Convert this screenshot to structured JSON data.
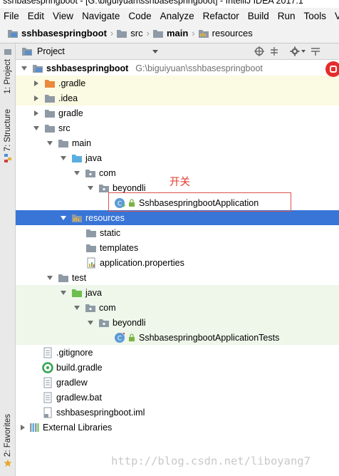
{
  "window": {
    "title": "sshbasespringboot - [G:\\biguiyuan\\sshbasespringboot] - IntelliJ IDEA 2017.1"
  },
  "menu": [
    "File",
    "Edit",
    "View",
    "Navigate",
    "Code",
    "Analyze",
    "Refactor",
    "Build",
    "Run",
    "Tools",
    "VCS"
  ],
  "breadcrumb": {
    "items": [
      "sshbasespringboot",
      "src",
      "main",
      "resources"
    ]
  },
  "left_tabs": {
    "project": "1: Project",
    "structure": "7: Structure",
    "favorites": "2: Favorites"
  },
  "panel": {
    "title": "Project"
  },
  "tree": {
    "root_name": "sshbasespringboot",
    "root_path": "G:\\biguiyuan\\sshbasespringboot",
    "rows": [
      {
        "label": ".gradle"
      },
      {
        "label": ".idea"
      },
      {
        "label": "gradle"
      },
      {
        "label": "src"
      },
      {
        "label": "main"
      },
      {
        "label": "java"
      },
      {
        "label": "com"
      },
      {
        "label": "beyondli"
      },
      {
        "label": "SshbasespringbootApplication"
      },
      {
        "label": "resources"
      },
      {
        "label": "static"
      },
      {
        "label": "templates"
      },
      {
        "label": "application.properties"
      },
      {
        "label": "test"
      },
      {
        "label": "java"
      },
      {
        "label": "com"
      },
      {
        "label": "beyondli"
      },
      {
        "label": "SshbasespringbootApplicationTests"
      },
      {
        "label": ".gitignore"
      },
      {
        "label": "build.gradle"
      },
      {
        "label": "gradlew"
      },
      {
        "label": "gradlew.bat"
      },
      {
        "label": "sshbasespringboot.iml"
      },
      {
        "label": "External Libraries"
      }
    ]
  },
  "annotation": "开关",
  "watermark": "http://blog.csdn.net/liboyang7",
  "colors": {
    "selection": "#3875d7",
    "annotation": "#e03b2f",
    "highlight_yellow": "#fbfae2",
    "highlight_green": "#eef7ea"
  }
}
